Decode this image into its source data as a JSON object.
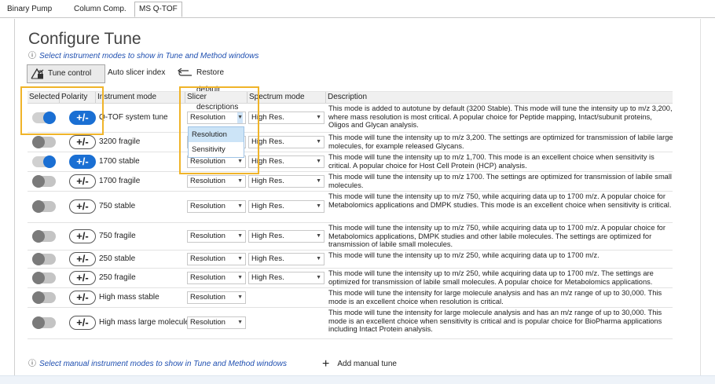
{
  "tabs": [
    "Binary Pump",
    "Column Comp.",
    "MS Q-TOF"
  ],
  "title": "Configure Tune",
  "subtitle": "Select instrument modes to show in Tune and Method windows",
  "info_glyph": "ⓘ",
  "toolbar": {
    "tune_control": "Tune control",
    "auto_slicer": "Auto slicer index",
    "restore": "Restore default descriptions"
  },
  "headers": {
    "selected": "Selected",
    "polarity": "Polarity",
    "mode": "Instrument mode",
    "slicer": "Slicer",
    "spectrum": "Spectrum mode",
    "description": "Description"
  },
  "polarity_label": "+/-",
  "rows": [
    {
      "selected": true,
      "polarity_on": true,
      "mode": "Q-TOF system tune",
      "slicer": "Resolution",
      "spectrum": "High Res.",
      "description": "This mode is added to autotune by default (3200 Stable). This mode will tune the intensity up to m/z 3,200, where mass resolution is most critical.  A popular choice for Peptide mapping, Intact/subunit proteins, Oligos and Glycan analysis."
    },
    {
      "selected": false,
      "polarity_on": false,
      "mode": "3200 fragile",
      "slicer": "Resolution",
      "spectrum": "High Res.",
      "description": "This mode will tune the intensity up to m/z 3,200. The settings are optimized for transmission of labile large molecules, for example released Glycans."
    },
    {
      "selected": true,
      "polarity_on": true,
      "mode": "1700 stable",
      "slicer": "Resolution",
      "spectrum": "High Res.",
      "description": "This mode will tune the intensity up to m/z 1,700. This mode is an excellent choice when sensitivity is critical. A popular choice for Host Cell Protein (HCP) analysis."
    },
    {
      "selected": false,
      "polarity_on": false,
      "mode": "1700 fragile",
      "slicer": "Resolution",
      "spectrum": "High Res.",
      "description": "This mode will tune the intensity up to m/z 1700. The settings are optimized for transmission of labile small molecules."
    },
    {
      "selected": false,
      "polarity_on": false,
      "mode": "750 stable",
      "slicer": "Resolution",
      "spectrum": "High Res.",
      "description": "This mode will tune the intensity up to m/z 750, while acquiring data up to 1700 m/z. A popular choice for Metabolomics applications and DMPK studies. This mode is an excellent choice when sensitivity is critical."
    },
    {
      "selected": false,
      "polarity_on": false,
      "mode": "750 fragile",
      "slicer": "Resolution",
      "spectrum": "High Res.",
      "description": "This mode will tune the intensity up to m/z 750, while acquiring data up to 1700 m/z. A popular choice for Metabolomics applications, DMPK studies and other labile molecules. The settings are optimized for transmission of labile small molecules."
    },
    {
      "selected": false,
      "polarity_on": false,
      "mode": "250 stable",
      "slicer": "Resolution",
      "spectrum": "High Res.",
      "description": "This mode will tune the intensity up to m/z 250, while acquiring data up to 1700 m/z."
    },
    {
      "selected": false,
      "polarity_on": false,
      "mode": "250 fragile",
      "slicer": "Resolution",
      "spectrum": "High Res.",
      "description": "This mode will tune the intensity up to m/z 250, while acquiring data up to 1700 m/z. The settings are optimized for transmission of labile small molecules.  A popular choice for Metabolomics applications."
    },
    {
      "selected": false,
      "polarity_on": false,
      "mode": "High mass stable",
      "slicer": "Resolution",
      "spectrum": "",
      "description": "This mode will tune the intensity for large molecule analysis and has an m/z range of up to 30,000. This mode is an excellent choice when resolution is critical."
    },
    {
      "selected": false,
      "polarity_on": false,
      "mode": "High mass large molecule",
      "slicer": "Resolution",
      "spectrum": "",
      "description": "This mode will tune the intensity for large molecule analysis and has an m/z range of up to 30,000. This mode is an excellent choice when sensitivity is critical and is popular choice for BioPharma applications including Intact Protein analysis."
    }
  ],
  "dropdown_options": [
    "Resolution",
    "Sensitivity"
  ],
  "footer": {
    "manual_text": "Select manual instrument modes to show in Tune and Method windows",
    "add_manual": "Add manual tune",
    "plus_glyph": "+"
  },
  "colors": {
    "accent": "#1a6fd3",
    "highlight": "#f0b429"
  }
}
